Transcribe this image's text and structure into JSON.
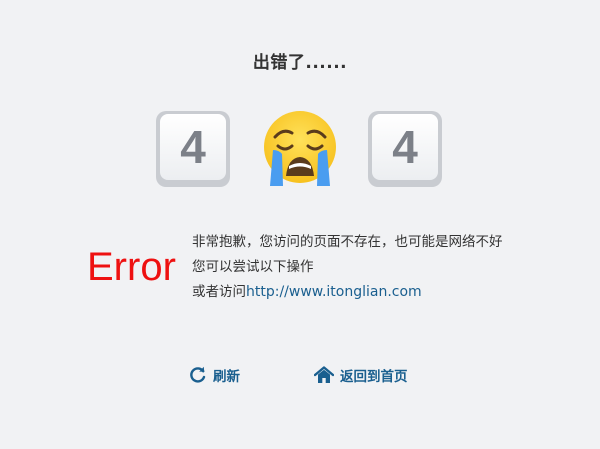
{
  "page": {
    "title": "出错了......"
  },
  "keys": {
    "left": "4",
    "right": "4"
  },
  "error_word": "Error",
  "message": {
    "line1": "非常抱歉，您访问的页面不存在，也可能是网络不好",
    "line2": "您可以尝试以下操作",
    "line3_prefix": "或者访问",
    "link": "http://www.itonglian.com"
  },
  "actions": {
    "refresh_label": "刷新",
    "home_label": "返回到首页"
  },
  "icons": {
    "emoji": "crying-face-icon",
    "refresh": "refresh-icon",
    "home": "home-icon"
  },
  "colors": {
    "background": "#f1f2f4",
    "error": "#ee1111",
    "link": "#1a5f8f"
  }
}
